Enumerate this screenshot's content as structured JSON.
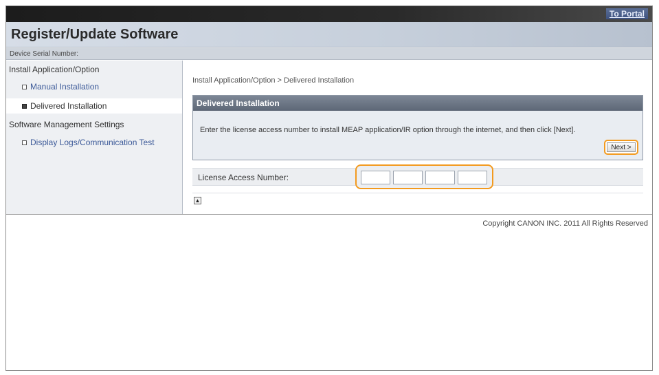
{
  "topbar": {
    "portal_link": "To Portal"
  },
  "header": {
    "title": "Register/Update Software"
  },
  "serial": {
    "label": "Device Serial Number:"
  },
  "sidebar": {
    "group1": "Install Application/Option",
    "items1": [
      {
        "label": "Manual Installation",
        "active": false
      },
      {
        "label": "Delivered Installation",
        "active": true
      }
    ],
    "group2": "Software Management Settings",
    "items2": [
      {
        "label": "Display Logs/Communication Test",
        "active": false
      }
    ]
  },
  "main": {
    "breadcrumb": "Install Application/Option > Delivered Installation",
    "panel_title": "Delivered Installation",
    "panel_message": "Enter the license access number to install MEAP application/IR option through the internet, and then click [Next].",
    "next_label": "Next >",
    "license_label": "License Access Number:",
    "license_fields": [
      "",
      "",
      "",
      ""
    ],
    "top_icon": "top-arrow-icon"
  },
  "footer": {
    "copyright": "Copyright CANON INC. 2011 All Rights Reserved"
  },
  "colors": {
    "highlight": "#f39a1e",
    "panel_header": "#6b7585",
    "link": "#3b5998"
  }
}
